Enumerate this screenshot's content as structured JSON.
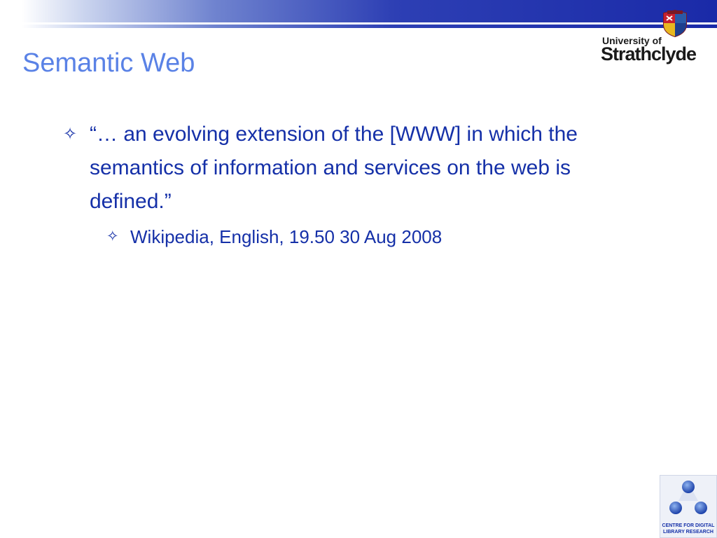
{
  "slide": {
    "title": "Semantic Web",
    "bullets": [
      {
        "marker": "✧",
        "text": "“… an evolving extension of the [WWW] in which the semantics of information and services on the web is defined.”",
        "sub_bullets": [
          {
            "marker": "✧",
            "text": "Wikipedia, English, 19.50 30 Aug 2008"
          }
        ]
      }
    ]
  },
  "branding": {
    "university_line1": "University of",
    "university_line2": "Strathclyde",
    "centre_text": "CENTRE FOR DIGITAL LIBRARY RESEARCH"
  },
  "colors": {
    "title": "#5a82e6",
    "body_text": "#1530a8",
    "header_bar": "#1a2aa8"
  }
}
